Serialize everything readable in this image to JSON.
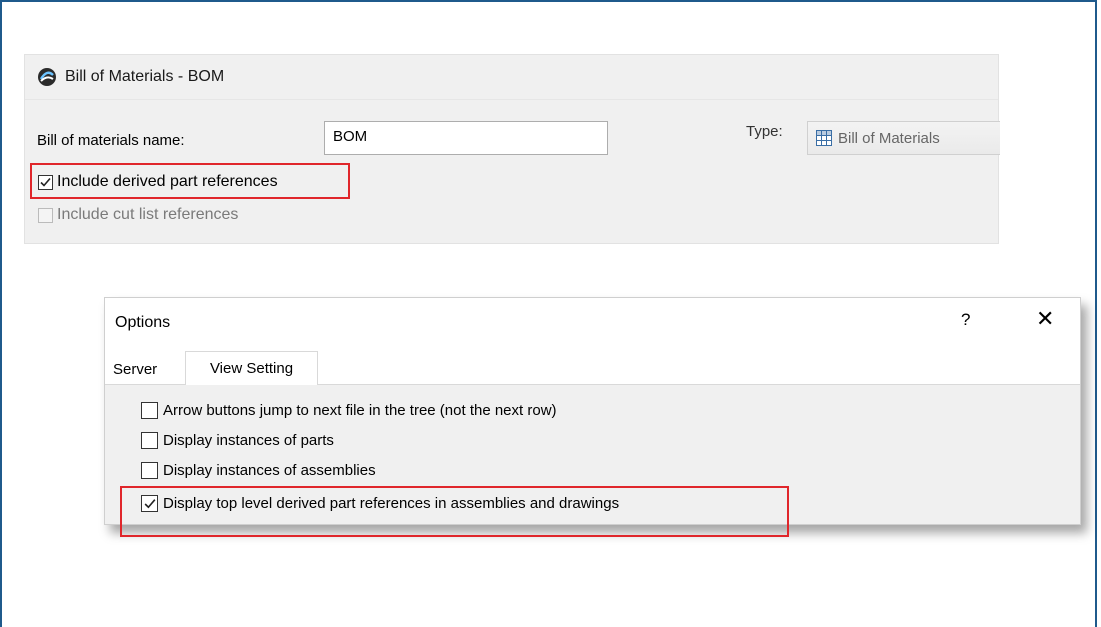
{
  "bom": {
    "title": "Bill of Materials - BOM",
    "name_label": "Bill of materials name:",
    "name_value": "BOM",
    "type_label": "Type:",
    "type_value": "Bill of Materials",
    "derived_refs_label": "Include derived part references",
    "derived_refs_checked": true,
    "cut_list_label": "Include cut list references",
    "cut_list_checked": false
  },
  "options": {
    "title": "Options",
    "help": "?",
    "close": "✕",
    "tabs": [
      {
        "label": "Server",
        "active": false
      },
      {
        "label": "View Setting",
        "active": true
      }
    ],
    "items": [
      {
        "label": "Arrow buttons jump to next file in the tree (not the next row)",
        "checked": false
      },
      {
        "label": "Display instances of parts",
        "checked": false
      },
      {
        "label": "Display instances of assemblies",
        "checked": false
      },
      {
        "label": "Display top level derived part references in assemblies and drawings",
        "checked": true
      }
    ]
  },
  "colors": {
    "highlight": "#e0262b",
    "frame": "#1f5a8c"
  }
}
